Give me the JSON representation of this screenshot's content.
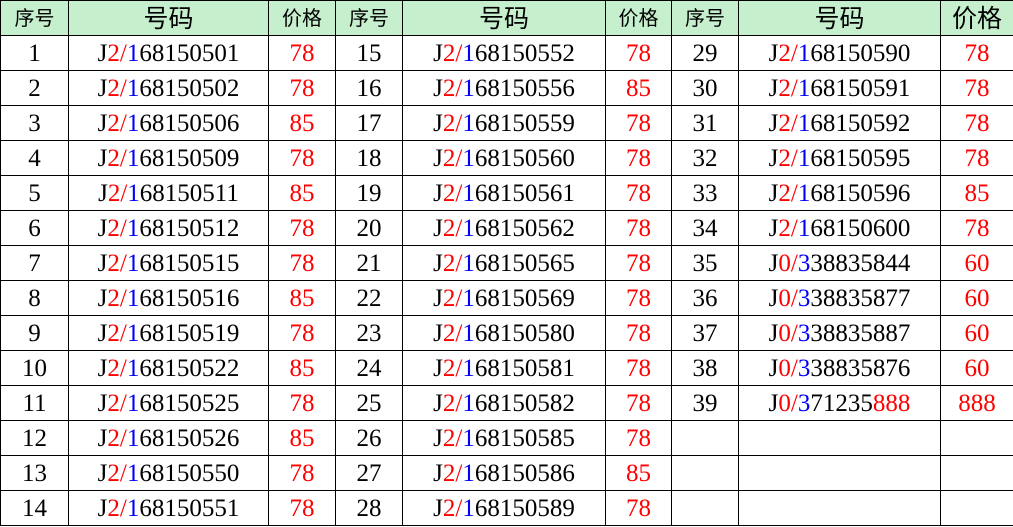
{
  "headers": [
    "序号",
    "号码",
    "价格",
    "序号",
    "号码",
    "价格",
    "序号",
    "号码",
    "价格"
  ],
  "colors": {
    "header_bg": "#c6efce",
    "price": "#ff0000",
    "digit_red": "#ff0000",
    "digit_blue": "#0000ff"
  },
  "rows": [
    [
      {
        "no": "1",
        "p": "J",
        "a": "2",
        "s": "/",
        "b": "1",
        "rest": "68150501",
        "red_tail": "",
        "price": "78"
      },
      {
        "no": "15",
        "p": "J",
        "a": "2",
        "s": "/",
        "b": "1",
        "rest": "68150552",
        "red_tail": "",
        "price": "78"
      },
      {
        "no": "29",
        "p": "J",
        "a": "2",
        "s": "/",
        "b": "1",
        "rest": "68150590",
        "red_tail": "",
        "price": "78"
      }
    ],
    [
      {
        "no": "2",
        "p": "J",
        "a": "2",
        "s": "/",
        "b": "1",
        "rest": "68150502",
        "red_tail": "",
        "price": "78"
      },
      {
        "no": "16",
        "p": "J",
        "a": "2",
        "s": "/",
        "b": "1",
        "rest": "68150556",
        "red_tail": "",
        "price": "85"
      },
      {
        "no": "30",
        "p": "J",
        "a": "2",
        "s": "/",
        "b": "1",
        "rest": "68150591",
        "red_tail": "",
        "price": "78"
      }
    ],
    [
      {
        "no": "3",
        "p": "J",
        "a": "2",
        "s": "/",
        "b": "1",
        "rest": "68150506",
        "red_tail": "",
        "price": "85"
      },
      {
        "no": "17",
        "p": "J",
        "a": "2",
        "s": "/",
        "b": "1",
        "rest": "68150559",
        "red_tail": "",
        "price": "78"
      },
      {
        "no": "31",
        "p": "J",
        "a": "2",
        "s": "/",
        "b": "1",
        "rest": "68150592",
        "red_tail": "",
        "price": "78"
      }
    ],
    [
      {
        "no": "4",
        "p": "J",
        "a": "2",
        "s": "/",
        "b": "1",
        "rest": "68150509",
        "red_tail": "",
        "price": "78"
      },
      {
        "no": "18",
        "p": "J",
        "a": "2",
        "s": "/",
        "b": "1",
        "rest": "68150560",
        "red_tail": "",
        "price": "78"
      },
      {
        "no": "32",
        "p": "J",
        "a": "2",
        "s": "/",
        "b": "1",
        "rest": "68150595",
        "red_tail": "",
        "price": "78"
      }
    ],
    [
      {
        "no": "5",
        "p": "J",
        "a": "2",
        "s": "/",
        "b": "1",
        "rest": "68150511",
        "red_tail": "",
        "price": "85"
      },
      {
        "no": "19",
        "p": "J",
        "a": "2",
        "s": "/",
        "b": "1",
        "rest": "68150561",
        "red_tail": "",
        "price": "78"
      },
      {
        "no": "33",
        "p": "J",
        "a": "2",
        "s": "/",
        "b": "1",
        "rest": "68150596",
        "red_tail": "",
        "price": "85"
      }
    ],
    [
      {
        "no": "6",
        "p": "J",
        "a": "2",
        "s": "/",
        "b": "1",
        "rest": "68150512",
        "red_tail": "",
        "price": "78"
      },
      {
        "no": "20",
        "p": "J",
        "a": "2",
        "s": "/",
        "b": "1",
        "rest": "68150562",
        "red_tail": "",
        "price": "78"
      },
      {
        "no": "34",
        "p": "J",
        "a": "2",
        "s": "/",
        "b": "1",
        "rest": "68150600",
        "red_tail": "",
        "price": "78"
      }
    ],
    [
      {
        "no": "7",
        "p": "J",
        "a": "2",
        "s": "/",
        "b": "1",
        "rest": "68150515",
        "red_tail": "",
        "price": "78"
      },
      {
        "no": "21",
        "p": "J",
        "a": "2",
        "s": "/",
        "b": "1",
        "rest": "68150565",
        "red_tail": "",
        "price": "78"
      },
      {
        "no": "35",
        "p": "J",
        "a": "0",
        "s": "/",
        "b": "3",
        "rest": "38835844",
        "red_tail": "",
        "price": "60"
      }
    ],
    [
      {
        "no": "8",
        "p": "J",
        "a": "2",
        "s": "/",
        "b": "1",
        "rest": "68150516",
        "red_tail": "",
        "price": "85"
      },
      {
        "no": "22",
        "p": "J",
        "a": "2",
        "s": "/",
        "b": "1",
        "rest": "68150569",
        "red_tail": "",
        "price": "78"
      },
      {
        "no": "36",
        "p": "J",
        "a": "0",
        "s": "/",
        "b": "3",
        "rest": "38835877",
        "red_tail": "",
        "price": "60"
      }
    ],
    [
      {
        "no": "9",
        "p": "J",
        "a": "2",
        "s": "/",
        "b": "1",
        "rest": "68150519",
        "red_tail": "",
        "price": "78"
      },
      {
        "no": "23",
        "p": "J",
        "a": "2",
        "s": "/",
        "b": "1",
        "rest": "68150580",
        "red_tail": "",
        "price": "78"
      },
      {
        "no": "37",
        "p": "J",
        "a": "0",
        "s": "/",
        "b": "3",
        "rest": "38835887",
        "red_tail": "",
        "price": "60"
      }
    ],
    [
      {
        "no": "10",
        "p": "J",
        "a": "2",
        "s": "/",
        "b": "1",
        "rest": "68150522",
        "red_tail": "",
        "price": "85"
      },
      {
        "no": "24",
        "p": "J",
        "a": "2",
        "s": "/",
        "b": "1",
        "rest": "68150581",
        "red_tail": "",
        "price": "78"
      },
      {
        "no": "38",
        "p": "J",
        "a": "0",
        "s": "/",
        "b": "3",
        "rest": "38835876",
        "red_tail": "",
        "price": "60"
      }
    ],
    [
      {
        "no": "11",
        "p": "J",
        "a": "2",
        "s": "/",
        "b": "1",
        "rest": "68150525",
        "red_tail": "",
        "price": "78"
      },
      {
        "no": "25",
        "p": "J",
        "a": "2",
        "s": "/",
        "b": "1",
        "rest": "68150582",
        "red_tail": "",
        "price": "78"
      },
      {
        "no": "39",
        "p": "J",
        "a": "0",
        "s": "/",
        "b": "3",
        "rest": "71235",
        "red_tail": "888",
        "price": "888"
      }
    ],
    [
      {
        "no": "12",
        "p": "J",
        "a": "2",
        "s": "/",
        "b": "1",
        "rest": "68150526",
        "red_tail": "",
        "price": "85"
      },
      {
        "no": "26",
        "p": "J",
        "a": "2",
        "s": "/",
        "b": "1",
        "rest": "68150585",
        "red_tail": "",
        "price": "78"
      },
      null
    ],
    [
      {
        "no": "13",
        "p": "J",
        "a": "2",
        "s": "/",
        "b": "1",
        "rest": "68150550",
        "red_tail": "",
        "price": "78"
      },
      {
        "no": "27",
        "p": "J",
        "a": "2",
        "s": "/",
        "b": "1",
        "rest": "68150586",
        "red_tail": "",
        "price": "85"
      },
      null
    ],
    [
      {
        "no": "14",
        "p": "J",
        "a": "2",
        "s": "/",
        "b": "1",
        "rest": "68150551",
        "red_tail": "",
        "price": "78"
      },
      {
        "no": "28",
        "p": "J",
        "a": "2",
        "s": "/",
        "b": "1",
        "rest": "68150589",
        "red_tail": "",
        "price": "78"
      },
      null
    ]
  ]
}
